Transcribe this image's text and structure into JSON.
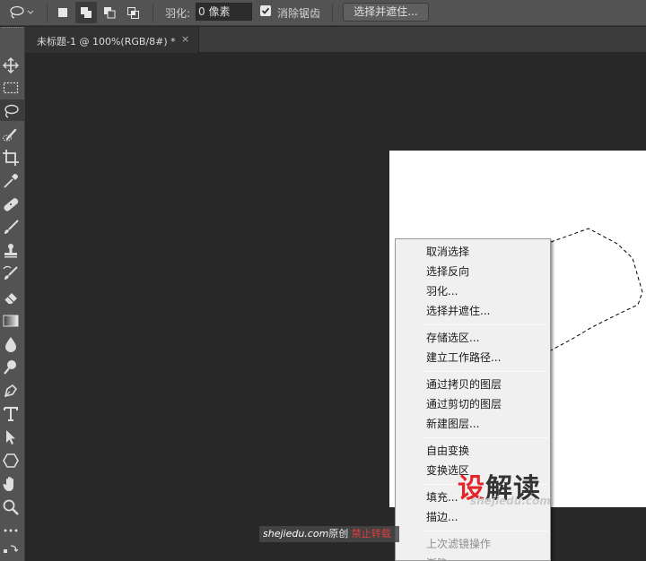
{
  "options_bar": {
    "feather_label": "羽化:",
    "feather_value": "0 像素",
    "anti_alias_label": "消除锯齿",
    "anti_alias_checked": true,
    "select_and_mask_label": "选择并遮住..."
  },
  "document_tab": {
    "title": "未标题-1 @ 100%(RGB/8#) *",
    "close_glyph": "×"
  },
  "tools": [
    "move-tool",
    "rectangular-marquee-tool",
    "lasso-tool",
    "quick-selection-tool",
    "crop-tool",
    "eyedropper-tool",
    "healing-brush-tool",
    "brush-tool",
    "clone-stamp-tool",
    "history-brush-tool",
    "eraser-tool",
    "gradient-tool",
    "blur-tool",
    "dodge-tool",
    "pen-tool",
    "type-tool",
    "path-selection-tool",
    "shape-tool",
    "hand-tool",
    "zoom-tool",
    "more-tools"
  ],
  "context_menu": {
    "items": [
      {
        "label": "取消选择"
      },
      {
        "label": "选择反向"
      },
      {
        "label": "羽化..."
      },
      {
        "label": "选择并遮住..."
      },
      {
        "label": "存储选区..."
      },
      {
        "label": "建立工作路径..."
      },
      {
        "label": "通过拷贝的图层"
      },
      {
        "label": "通过剪切的图层"
      },
      {
        "label": "新建图层..."
      },
      {
        "label": "自由变换"
      },
      {
        "label": "变换选区"
      },
      {
        "label": "填充..."
      },
      {
        "label": "描边..."
      },
      {
        "label": "上次滤镜操作"
      },
      {
        "label": "渐隐..."
      }
    ]
  },
  "watermark": {
    "logo_red": "设",
    "logo_dark": "解读",
    "logo_sub": "shejiedu.com",
    "strip_site": "shejiedu.com",
    "strip_original": "原创",
    "strip_ban": "禁止转载"
  },
  "colors": {
    "panel": "#535353",
    "workspace": "#282828",
    "canvas": "#ffffff",
    "menu_bg": "#f0f0f0",
    "watermark_red": "#e2262a"
  }
}
